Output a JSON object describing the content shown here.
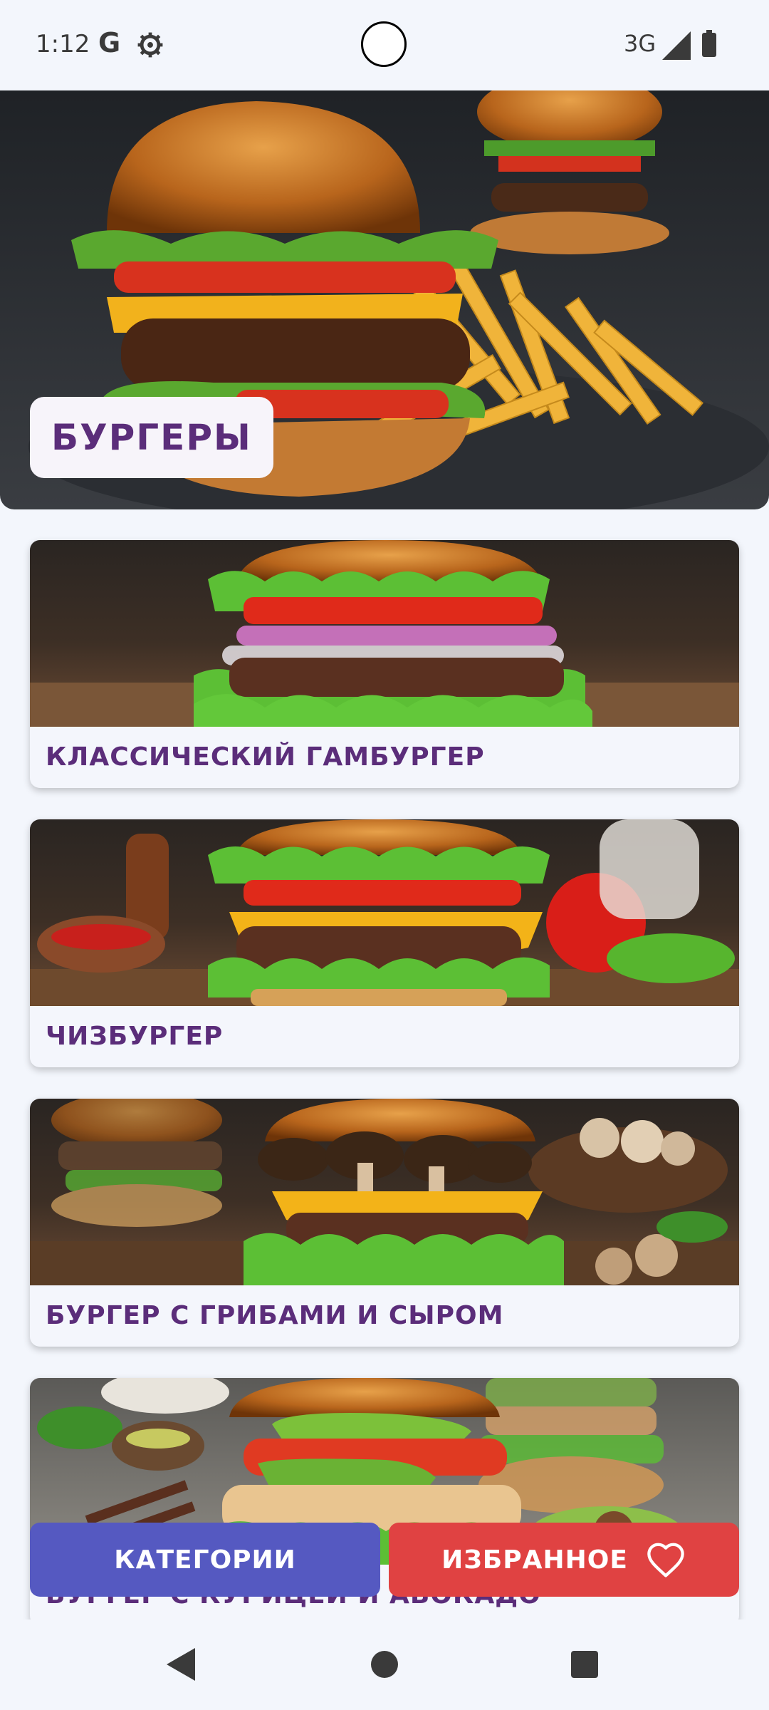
{
  "status_bar": {
    "time": "1:12",
    "g_icon": "G",
    "network": "3G",
    "icons": [
      "google-icon",
      "settings-gear-icon",
      "camera-cutout",
      "cell-signal-icon",
      "battery-icon"
    ]
  },
  "header": {
    "title": "БУРГЕРЫ",
    "image": "burger-with-fries-photo"
  },
  "recipes": [
    {
      "title": "КЛАССИЧЕСКИЙ ГАМБУРГЕР",
      "image": "classic-hamburger-photo"
    },
    {
      "title": "ЧИЗБУРГЕР",
      "image": "cheeseburger-photo"
    },
    {
      "title": "БУРГЕР С ГРИБАМИ И СЫРОМ",
      "image": "mushroom-cheese-burger-photo"
    },
    {
      "title": "БУРГЕР С КУРИЦЕЙ И АВОКАДО",
      "image": "chicken-avocado-burger-photo"
    }
  ],
  "buttons": {
    "categories": "КАТЕГОРИИ",
    "favorites": "ИЗБРАННОЕ",
    "favorites_icon": "heart-outline-icon"
  },
  "nav_bar": {
    "icons": [
      "back-icon",
      "home-icon",
      "recents-icon"
    ]
  },
  "colors": {
    "accent_text": "#5b2d7a",
    "categories_button": "#5559c1",
    "favorites_button": "#e04242",
    "background": "#f3f6fc"
  }
}
